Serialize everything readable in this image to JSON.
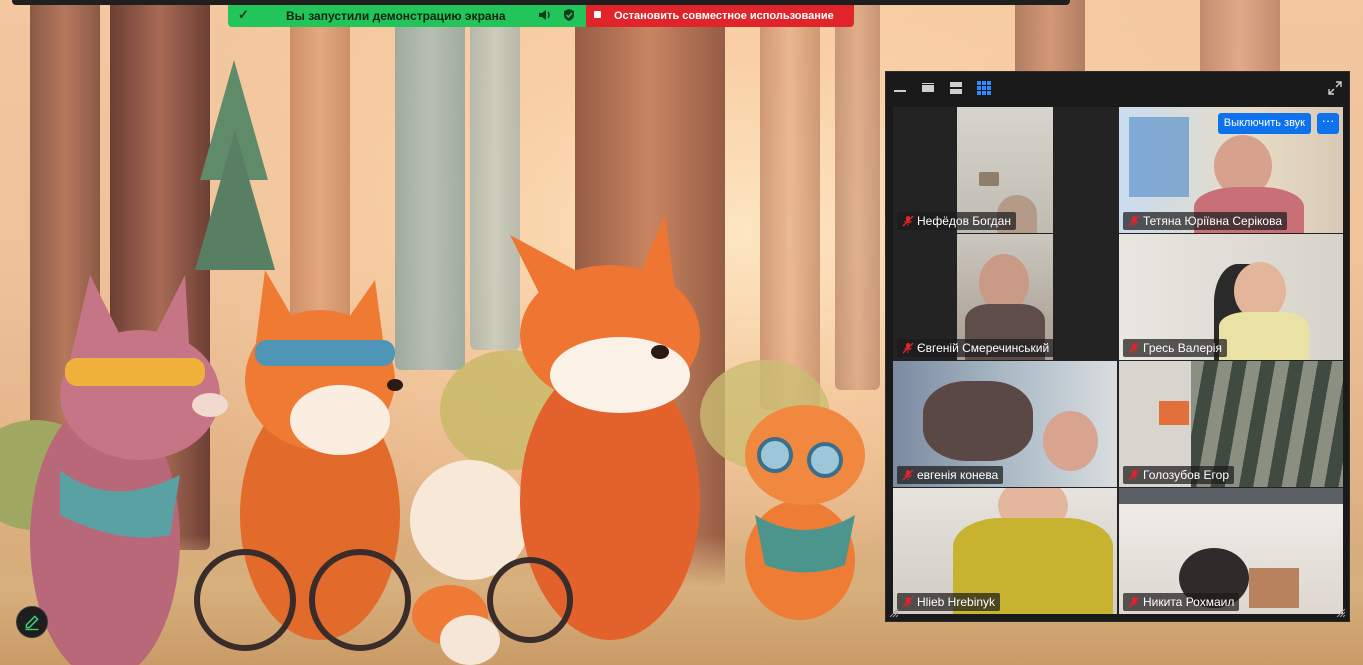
{
  "share_bar": {
    "status_text": "Вы запустили демонстрацию экрана",
    "stop_label": "Остановить совместное использование"
  },
  "panel": {
    "view_options": [
      "minimize-icon",
      "speaker-view-icon",
      "filmstrip-view-icon",
      "gallery-view-icon"
    ],
    "active_view": "gallery-view-icon"
  },
  "tile_actions": {
    "mute_label": "Выключить звук",
    "more_label": "···"
  },
  "participants": [
    {
      "name": "Нефёдов Богдан",
      "muted": true
    },
    {
      "name": "Тетяна Юріївна Серікова",
      "muted": true
    },
    {
      "name": "Євгеній Смеречинський",
      "muted": true
    },
    {
      "name": "Гресь Валерія",
      "muted": true
    },
    {
      "name": "евгенія  конева",
      "muted": true
    },
    {
      "name": "Голозубов Егор",
      "muted": true
    },
    {
      "name": "Hlieb Hrebinyk",
      "muted": true
    },
    {
      "name": "Никита Рохмаил",
      "muted": true,
      "active_speaker": true
    }
  ],
  "colors": {
    "share_green": "#23c45a",
    "stop_red": "#e0242a",
    "accent_blue": "#0e72ed",
    "active_speaker_border": "#29c36a",
    "muted_mic": "#e0242a"
  }
}
